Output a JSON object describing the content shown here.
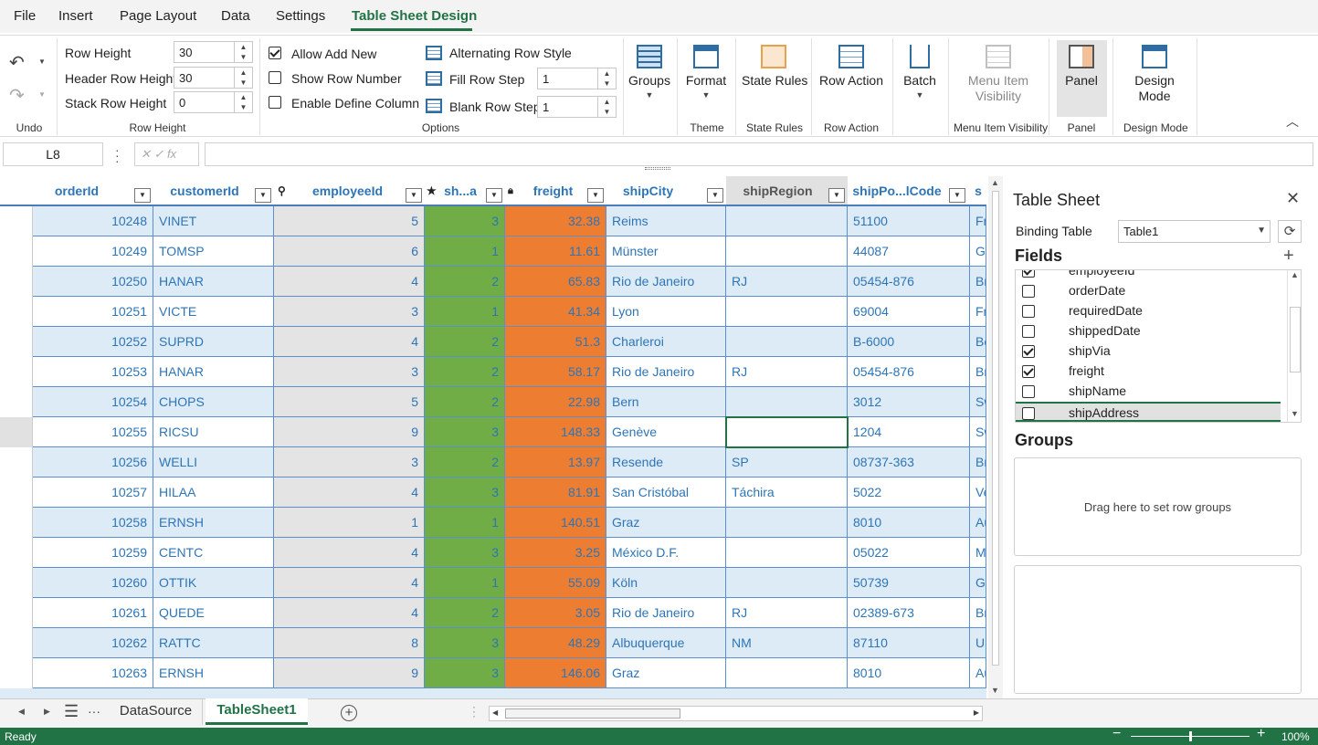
{
  "menu": {
    "tabs": [
      {
        "label": "File"
      },
      {
        "label": "Insert"
      },
      {
        "label": "Page Layout"
      },
      {
        "label": "Data"
      },
      {
        "label": "Settings"
      },
      {
        "label": "Table Sheet Design"
      }
    ],
    "active_tab": "Table Sheet Design"
  },
  "ribbon": {
    "undo_group": "Undo",
    "row_height": {
      "label": "Row Height",
      "row_height_label": "Row Height",
      "row_height_value": "30",
      "header_row_height_label": "Header Row Height",
      "header_row_height_value": "30",
      "stack_row_height_label": "Stack Row Height",
      "stack_row_height_value": "0"
    },
    "options": {
      "label": "Options",
      "allow_add_new": "Allow Add New",
      "allow_add_new_checked": true,
      "show_row_number": "Show Row Number",
      "show_row_number_checked": false,
      "enable_define_column": "Enable Define Column",
      "enable_define_column_checked": false,
      "alternating_row_style": "Alternating Row Style",
      "fill_row_step": "Fill Row Step",
      "fill_row_step_value": "1",
      "blank_row_step": "Blank Row Step",
      "blank_row_step_value": "1"
    },
    "groups_btn": "Groups",
    "theme": {
      "btn": "Format",
      "label": "Theme"
    },
    "state_rules": {
      "btn": "State Rules",
      "label": "State Rules"
    },
    "row_action": {
      "btn": "Row Action",
      "label": "Row Action"
    },
    "batch_btn": "Batch",
    "menu_item_visibility": {
      "btn_line1": "Menu Item",
      "btn_line2": "Visibility",
      "label": "Menu Item Visibility"
    },
    "panel": {
      "btn": "Panel",
      "label": "Panel"
    },
    "design_mode": {
      "btn_line1": "Design",
      "btn_line2": "Mode",
      "label": "Design Mode"
    }
  },
  "formula_bar": {
    "name_box": "L8",
    "fx": "fx",
    "formula": ""
  },
  "grid": {
    "columns": [
      "orderId",
      "customerId",
      "employeeId",
      "sh...a",
      "freight",
      "shipCity",
      "shipRegion",
      "shipPo...lCode",
      "s"
    ],
    "rows": [
      [
        "10248",
        "VINET",
        "5",
        "3",
        "32.38",
        "Reims",
        "",
        "51100",
        "Fr"
      ],
      [
        "10249",
        "TOMSP",
        "6",
        "1",
        "11.61",
        "Münster",
        "",
        "44087",
        "G"
      ],
      [
        "10250",
        "HANAR",
        "4",
        "2",
        "65.83",
        "Rio de Janeiro",
        "RJ",
        "05454-876",
        "Br"
      ],
      [
        "10251",
        "VICTE",
        "3",
        "1",
        "41.34",
        "Lyon",
        "",
        "69004",
        "Fr"
      ],
      [
        "10252",
        "SUPRD",
        "4",
        "2",
        "51.3",
        "Charleroi",
        "",
        "B-6000",
        "Be"
      ],
      [
        "10253",
        "HANAR",
        "3",
        "2",
        "58.17",
        "Rio de Janeiro",
        "RJ",
        "05454-876",
        "Br"
      ],
      [
        "10254",
        "CHOPS",
        "5",
        "2",
        "22.98",
        "Bern",
        "",
        "3012",
        "Sw"
      ],
      [
        "10255",
        "RICSU",
        "9",
        "3",
        "148.33",
        "Genève",
        "",
        "1204",
        "Sw"
      ],
      [
        "10256",
        "WELLI",
        "3",
        "2",
        "13.97",
        "Resende",
        "SP",
        "08737-363",
        "Br"
      ],
      [
        "10257",
        "HILAA",
        "4",
        "3",
        "81.91",
        "San Cristóbal",
        "Táchira",
        "5022",
        "Ve"
      ],
      [
        "10258",
        "ERNSH",
        "1",
        "1",
        "140.51",
        "Graz",
        "",
        "8010",
        "Au"
      ],
      [
        "10259",
        "CENTC",
        "4",
        "3",
        "3.25",
        "México D.F.",
        "",
        "05022",
        "Me"
      ],
      [
        "10260",
        "OTTIK",
        "4",
        "1",
        "55.09",
        "Köln",
        "",
        "50739",
        "Ge"
      ],
      [
        "10261",
        "QUEDE",
        "4",
        "2",
        "3.05",
        "Rio de Janeiro",
        "RJ",
        "02389-673",
        "Br"
      ],
      [
        "10262",
        "RATTC",
        "8",
        "3",
        "48.29",
        "Albuquerque",
        "NM",
        "87110",
        "US"
      ],
      [
        "10263",
        "ERNSH",
        "9",
        "3",
        "146.06",
        "Graz",
        "",
        "8010",
        "Au"
      ]
    ],
    "selected_row": 7,
    "selected_column": "shipRegion",
    "colors": {
      "shipVia_fill": "#70ad47",
      "freight_fill": "#ed7d31",
      "alt_row": "#ddebf7",
      "employee_fill": "#e4e4e4",
      "accent": "#217346"
    }
  },
  "panel": {
    "title": "Table Sheet",
    "binding_label": "Binding Table",
    "binding_value": "Table1",
    "fields_title": "Fields",
    "fields": [
      {
        "name": "employeeId",
        "checked": true
      },
      {
        "name": "orderDate",
        "checked": false
      },
      {
        "name": "requiredDate",
        "checked": false
      },
      {
        "name": "shippedDate",
        "checked": false
      },
      {
        "name": "shipVia",
        "checked": true
      },
      {
        "name": "freight",
        "checked": true
      },
      {
        "name": "shipName",
        "checked": false
      },
      {
        "name": "shipAddress",
        "checked": false
      }
    ],
    "groups_title": "Groups",
    "groups_placeholder": "Drag here to set row groups"
  },
  "sheet_tabs": {
    "tabs": [
      "DataSource",
      "TableSheet1"
    ],
    "active": "TableSheet1"
  },
  "status": {
    "text": "Ready",
    "zoom": "100%"
  }
}
